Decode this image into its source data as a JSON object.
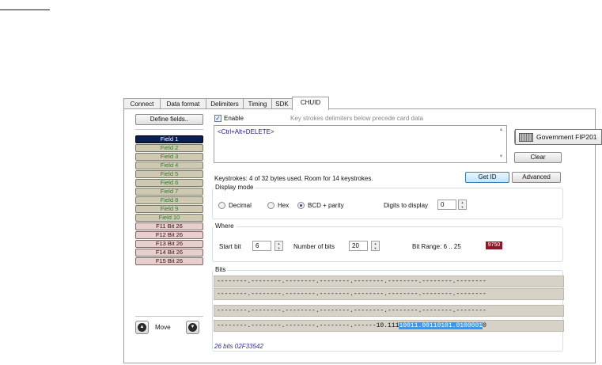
{
  "tabs": [
    {
      "label": "Connect",
      "active": false
    },
    {
      "label": "Data format",
      "active": false
    },
    {
      "label": "Delimiters",
      "active": false
    },
    {
      "label": "Timing",
      "active": false
    },
    {
      "label": "SDK",
      "active": false
    },
    {
      "label": "CHUID",
      "active": true
    }
  ],
  "left": {
    "define_fields_label": "Define fields..",
    "fields": [
      "Field 1",
      "Field 2",
      "Field 3",
      "Field 4",
      "Field 5",
      "Field 6",
      "Field 7",
      "Field 8",
      "Field 9",
      "Field 10",
      "F11 Bit 26",
      "F12 Bit 26",
      "F13 Bit 26",
      "F14 Bit 26",
      "F15 Bit 26"
    ],
    "selected_field": "Field 1",
    "move_label": "Move"
  },
  "enable": {
    "label": "Enable",
    "checked": true,
    "hint": "Key strokes delimiters below precede card data"
  },
  "keystrokes_text": "<Ctrl+Alt+DELETE>",
  "tooltip": "Government FIP201",
  "clear_label": "Clear",
  "status_text": "Keystrokes: 4 of 32 bytes used. Room for 14 keystrokes.",
  "get_id_label": "Get ID",
  "advanced_label": "Advanced",
  "display_mode": {
    "legend": "Display mode",
    "options": [
      "Decimal",
      "Hex",
      "BCD + parity"
    ],
    "selected": "BCD + parity",
    "digits_label": "Digits to display",
    "digits_value": "0"
  },
  "where": {
    "legend": "Where",
    "start_bit_label": "Start bit",
    "start_bit_value": "6",
    "num_bits_label": "Number of bits",
    "num_bits_value": "20",
    "bit_range_text": "Bit Range: 6 .. 25",
    "swatch_text": "9750",
    "swatch_color": "#8a1a2a"
  },
  "bits": {
    "legend": "Bits",
    "rows": [
      "--------.--------.--------.--------.--------.--------.--------.--------",
      "--------.--------.--------.--------.--------.--------.--------.--------",
      "--------.--------.--------.--------.--------.--------.--------.--------"
    ],
    "last_row_prefix": "--------.--------.--------.--------.------10.111",
    "last_row_highlight": "10011.00110101.0100001",
    "last_row_suffix": "0",
    "highlight_color": "#3399ff",
    "summary": "26 bits 02F33542"
  }
}
